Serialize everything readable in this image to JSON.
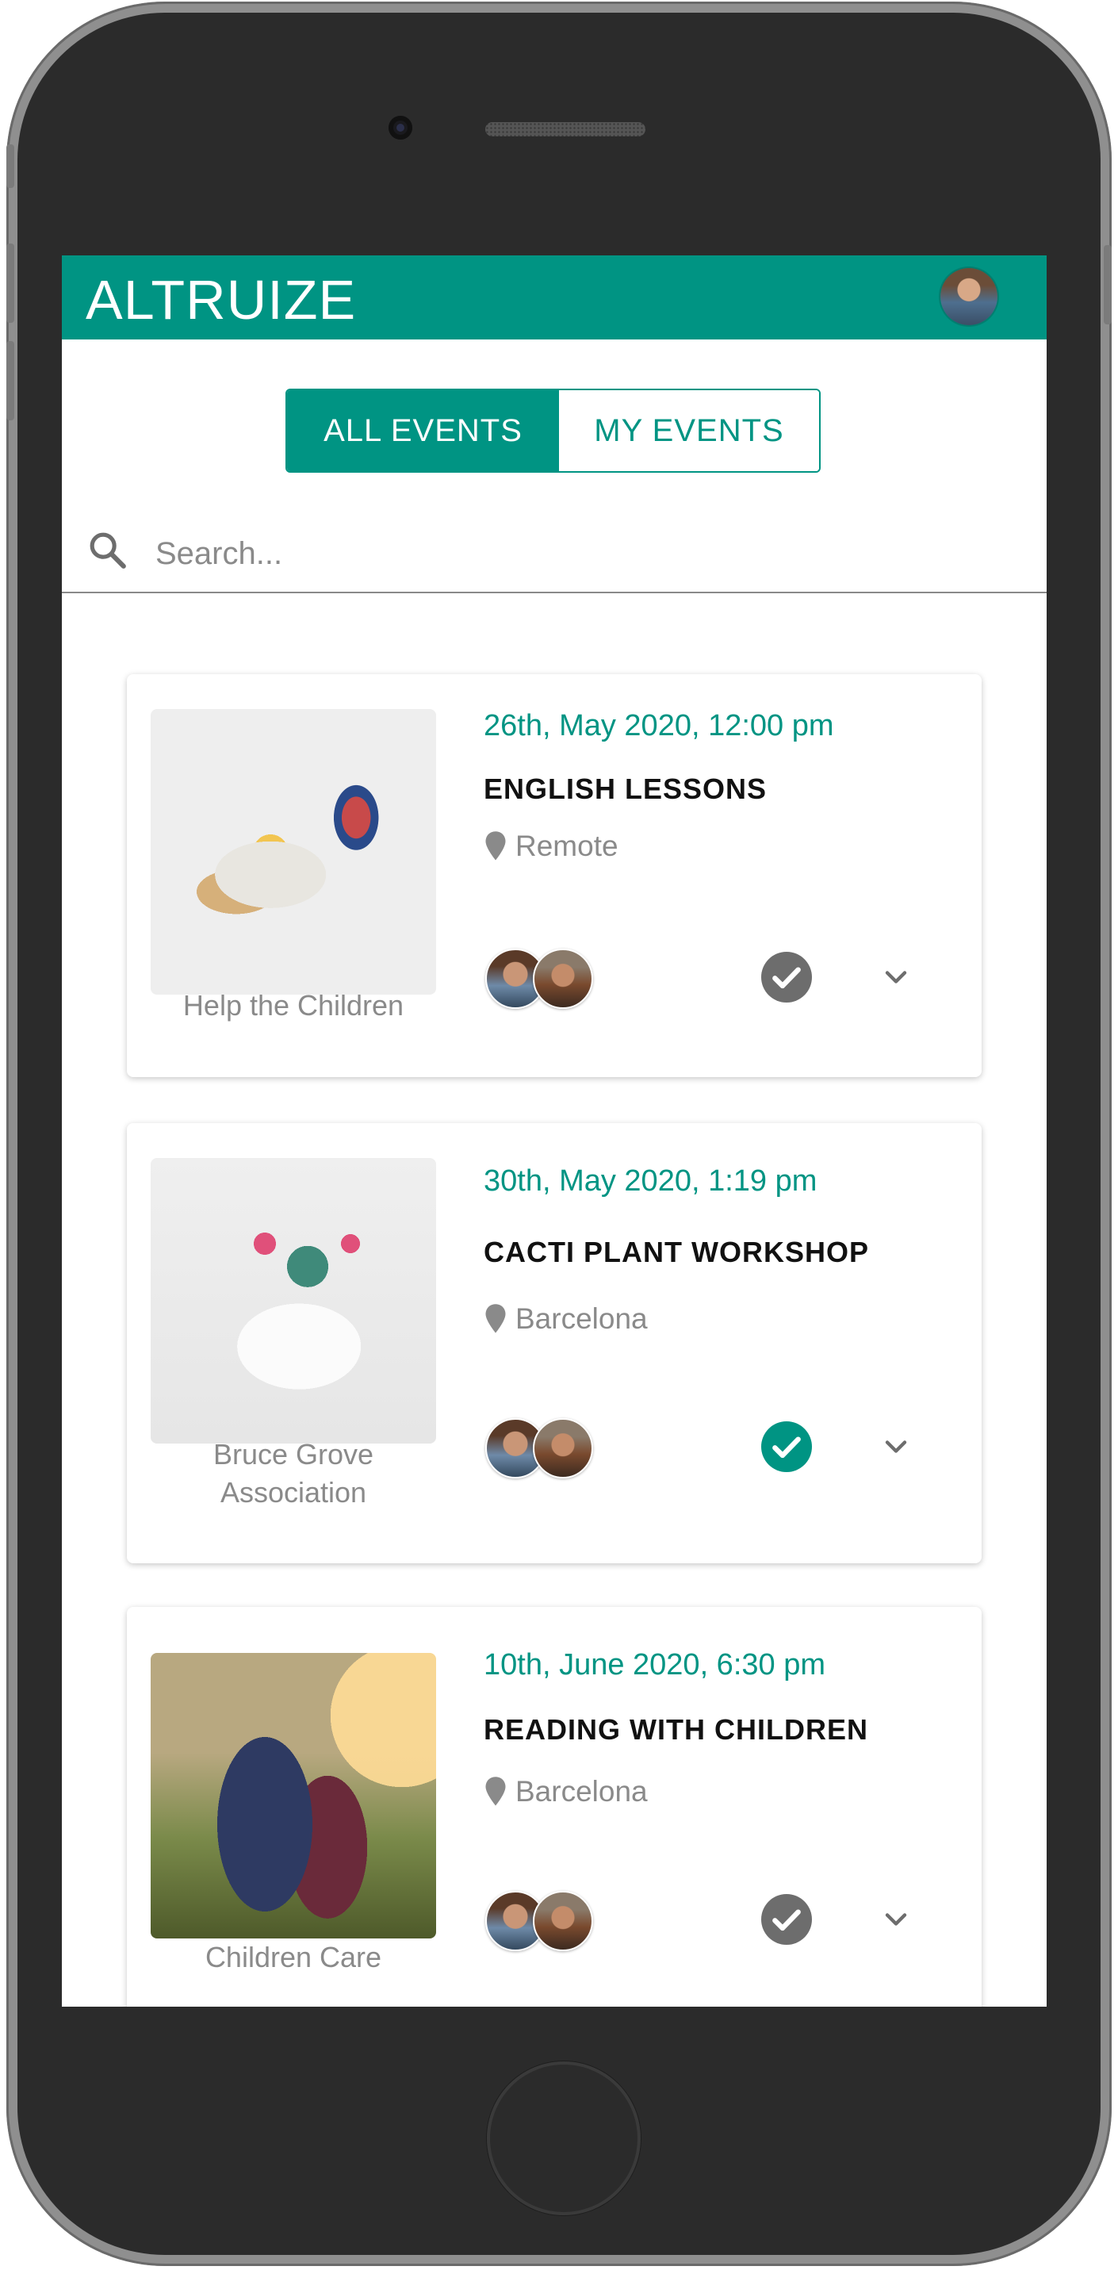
{
  "app": {
    "title": "ALTRUIZE"
  },
  "tabs": {
    "all_label": "ALL EVENTS",
    "my_label": "MY EVENTS",
    "selected": "ALL EVENTS"
  },
  "search": {
    "placeholder": "Search...",
    "value": ""
  },
  "events": [
    {
      "date": "26th, May 2020, 12:00 pm",
      "title": "ENGLISH LESSONS",
      "location": "Remote",
      "organization": "Help the Children",
      "attending": false,
      "check_color": "#6d6d6d",
      "image": "egg-and-mug-photo"
    },
    {
      "date": "30th, May 2020, 1:19 pm",
      "title": "CACTI PLANT WORKSHOP",
      "location": "Barcelona",
      "organization": "Bruce Grove Association",
      "attending": true,
      "check_color": "#009483",
      "image": "cactus-in-cup-photo"
    },
    {
      "date": "10th, June 2020, 6:30 pm",
      "title": "READING WITH CHILDREN",
      "location": "Barcelona",
      "organization": "Children Care",
      "attending": false,
      "check_color": "#6d6d6d",
      "image": "children-reading-photo"
    }
  ],
  "colors": {
    "brand": "#009483",
    "muted": "#8a8a8a",
    "frame": "#2b2b2b"
  }
}
